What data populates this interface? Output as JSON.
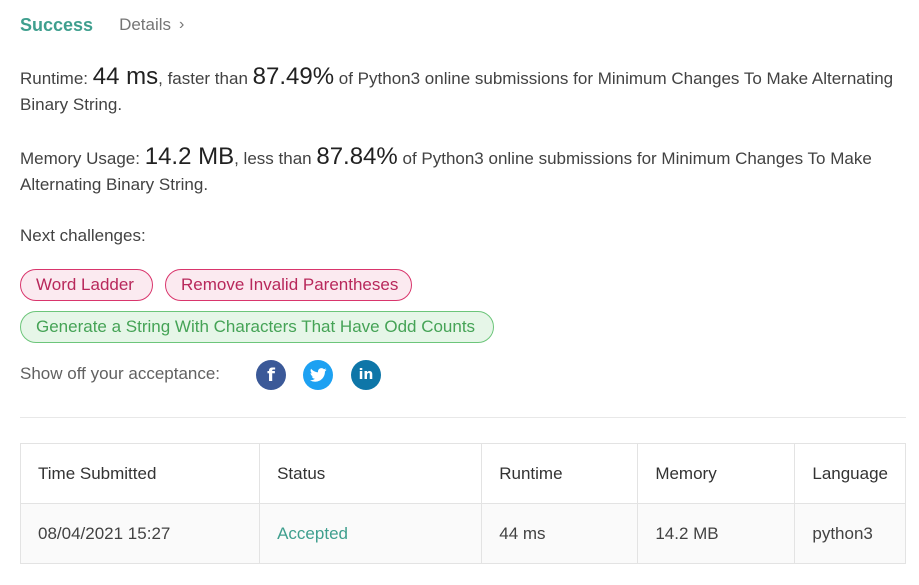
{
  "header": {
    "status": "Success",
    "details_label": "Details",
    "details_chevron": "›"
  },
  "runtime": {
    "label": "Runtime:",
    "value": "44 ms",
    "comparison": ", faster than",
    "percent": "87.49%",
    "suffix": "of Python3 online submissions for Minimum Changes To Make Alternating Binary String."
  },
  "memory": {
    "label": "Memory Usage:",
    "value": "14.2 MB",
    "comparison": ", less than",
    "percent": "87.84%",
    "suffix": "of Python3 online submissions for Minimum Changes To Make Alternating Binary String."
  },
  "next_challenges": {
    "label": "Next challenges:",
    "items": [
      {
        "label": "Word Ladder",
        "difficulty": "hard"
      },
      {
        "label": "Remove Invalid Parentheses",
        "difficulty": "hard"
      },
      {
        "label": "Generate a String With Characters That Have Odd Counts",
        "difficulty": "easy"
      }
    ]
  },
  "share": {
    "label": "Show off your acceptance:",
    "icons": [
      "facebook-icon",
      "twitter-icon",
      "linkedin-icon"
    ],
    "facebook_glyph": "f",
    "linkedin_glyph": "in"
  },
  "colors": {
    "accent_green": "#3f9f8e",
    "hard_tag": "#d9356c",
    "easy_tag": "#6cc57a",
    "facebook": "#3b5998",
    "twitter": "#1da1f2",
    "linkedin": "#0e76a8"
  },
  "submissions": {
    "columns": [
      "Time Submitted",
      "Status",
      "Runtime",
      "Memory",
      "Language"
    ],
    "rows": [
      {
        "time": "08/04/2021 15:27",
        "status": "Accepted",
        "runtime": "44 ms",
        "memory": "14.2 MB",
        "language": "python3"
      }
    ]
  }
}
